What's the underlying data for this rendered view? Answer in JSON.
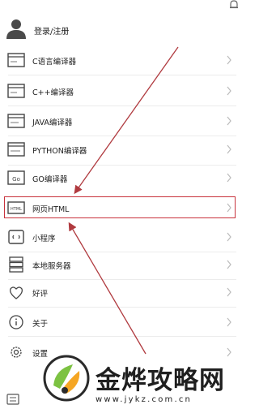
{
  "login": {
    "label": "登录/注册"
  },
  "menu": [
    {
      "label": "C语言编译器",
      "icon": "c-compiler-icon"
    },
    {
      "label": "C++编译器",
      "icon": "cpp-compiler-icon"
    },
    {
      "label": "JAVA编译器",
      "icon": "java-compiler-icon"
    },
    {
      "label": "PYTHON编译器",
      "icon": "python-compiler-icon"
    },
    {
      "label": "GO编译器",
      "icon": "go-compiler-icon"
    },
    {
      "label": "网页HTML",
      "icon": "html-page-icon"
    },
    {
      "label": "小程序",
      "icon": "mini-program-icon"
    },
    {
      "label": "本地服务器",
      "icon": "server-icon"
    },
    {
      "label": "好评",
      "icon": "heart-icon"
    },
    {
      "label": "关于",
      "icon": "info-icon"
    },
    {
      "label": "设置",
      "icon": "gear-icon"
    }
  ],
  "icon_glyphs": {
    "go": "Go",
    "html": "HTML"
  },
  "watermark": {
    "title": "金烨攻略网",
    "url": "www.jykz.com.cn"
  },
  "colors": {
    "highlight": "#c8323c",
    "arrow": "#b03a3f",
    "logo_green": "#7cc242",
    "logo_orange": "#f5a623"
  }
}
